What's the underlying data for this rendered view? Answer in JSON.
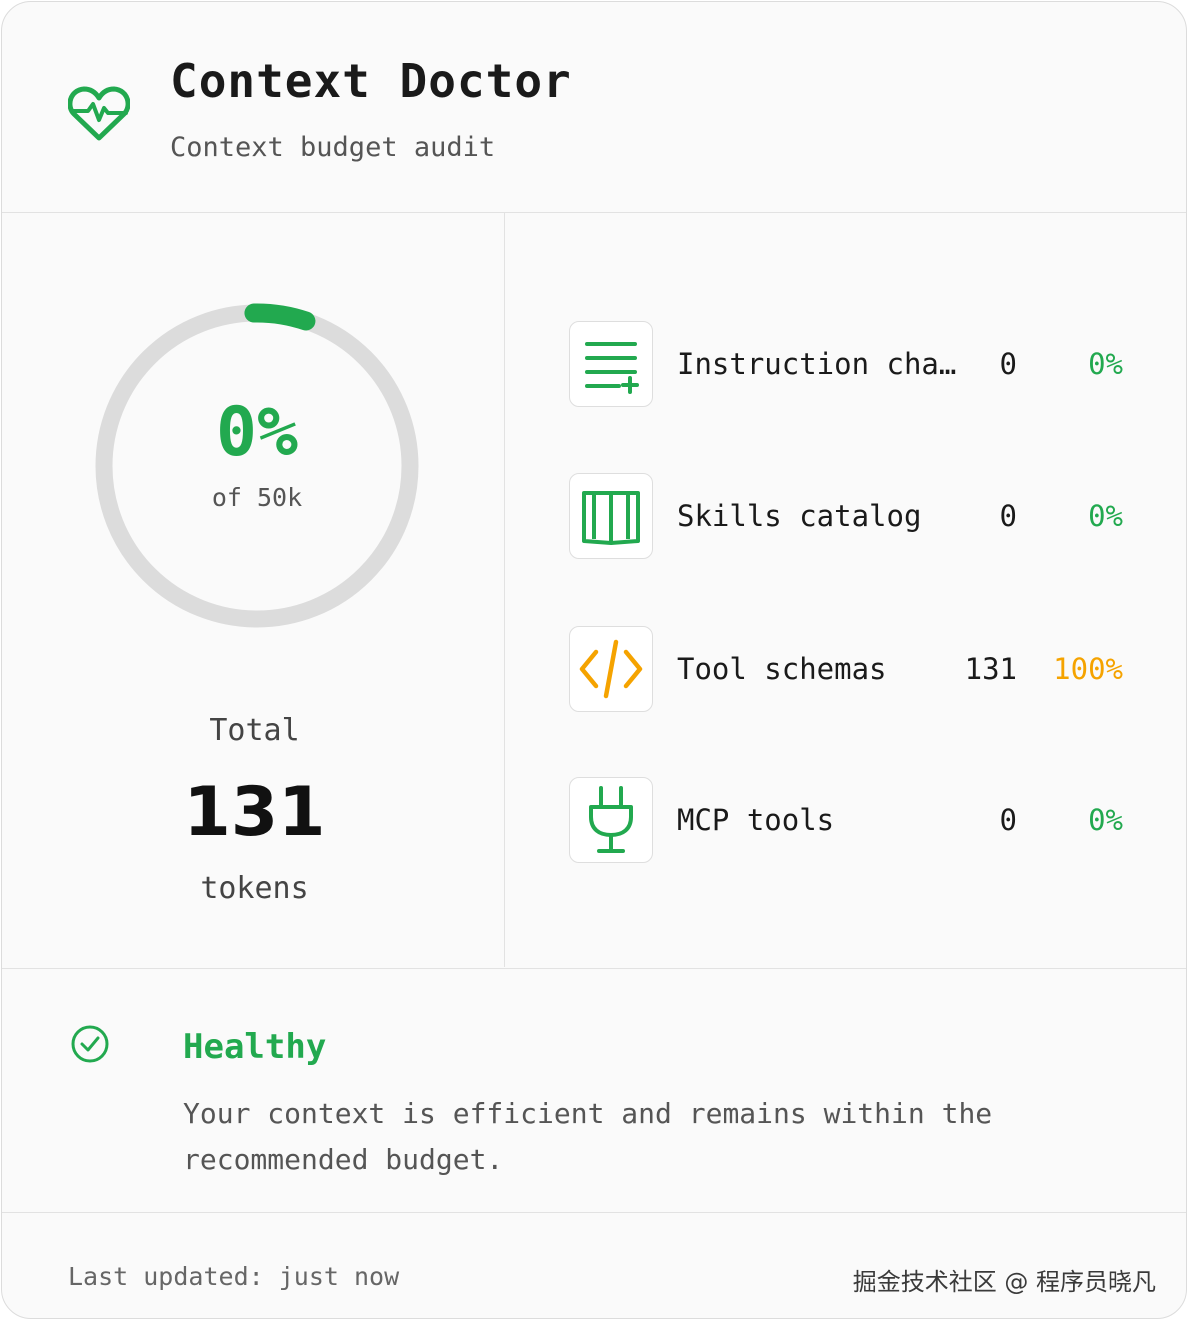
{
  "header": {
    "title": "Context Doctor",
    "subtitle": "Context budget audit",
    "logo_icon": "heartbeat-icon"
  },
  "usage": {
    "percent_label": "0%",
    "of_label": "of 50k",
    "fraction_used": 0.0026,
    "total_label": "Total",
    "total_value": "131",
    "total_unit": "tokens"
  },
  "categories": [
    {
      "icon": "list-add-icon",
      "label": "Instruction cha…",
      "count": "0",
      "percent": "0%",
      "color": "#22a94f"
    },
    {
      "icon": "book-icon",
      "label": "Skills catalog",
      "count": "0",
      "percent": "0%",
      "color": "#22a94f"
    },
    {
      "icon": "code-icon",
      "label": "Tool schemas",
      "count": "131",
      "percent": "100%",
      "color": "#f5a300"
    },
    {
      "icon": "plug-icon",
      "label": "MCP tools",
      "count": "0",
      "percent": "0%",
      "color": "#22a94f"
    }
  ],
  "status": {
    "icon": "check-circle-icon",
    "heading": "Healthy",
    "message": "Your context is efficient and remains within the recommended budget."
  },
  "footer": {
    "updated": "Last updated: just now",
    "watermark": "掘金技术社区 @ 程序员晓凡"
  },
  "colors": {
    "accent": "#22a94f",
    "warning": "#f5a300",
    "ring_track": "#dcdcdc"
  }
}
